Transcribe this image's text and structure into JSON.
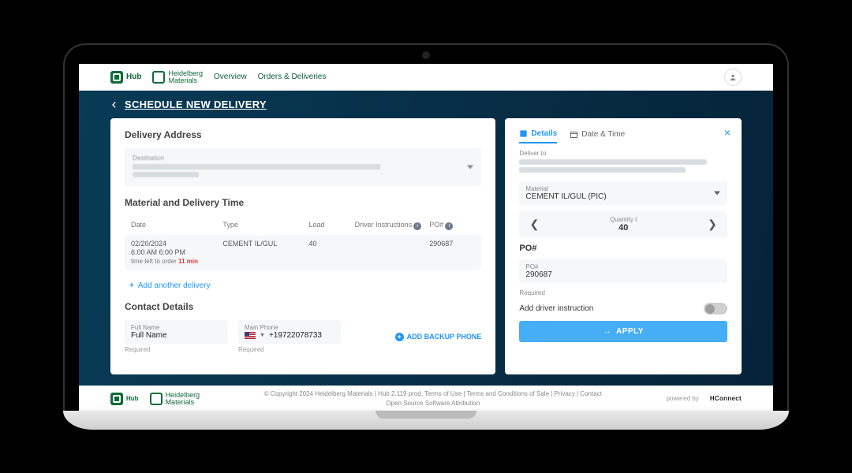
{
  "nav": {
    "hub": "Hub",
    "hm": "Heidelberg\nMaterials",
    "links": [
      "Overview",
      "Orders & Deliveries"
    ]
  },
  "page_title": "SCHEDULE NEW DELIVERY",
  "left": {
    "delivery_address_title": "Delivery Address",
    "dest_label": "Destination",
    "material_title": "Material and Delivery Time",
    "table": {
      "headers": [
        "Date",
        "Type",
        "Load",
        "Driver Instructions",
        "PO#"
      ],
      "row": {
        "date": "02/20/2024",
        "time": "6:00 AM 6:00 PM",
        "time_left_prefix": "time left to order",
        "time_left_value": "11 min",
        "type": "CEMENT IL/GUL",
        "load": "40",
        "po": "290687"
      }
    },
    "add_another": "Add another delivery",
    "contact_title": "Contact Details",
    "fullname_label": "Full Name",
    "fullname_value": "Full Name",
    "mainphone_label": "Main Phone",
    "mainphone_value": "+19722078733",
    "required": "Required",
    "add_backup": "ADD BACKUP PHONE"
  },
  "right": {
    "tab_details": "Details",
    "tab_datetime": "Date & Time",
    "deliver_to": "Deliver to",
    "material_label": "Material",
    "material_value": "CEMENT IL/GUL (PIC)",
    "qty_label": "Quantity t",
    "qty_value": "40",
    "po_title": "PO#",
    "po_label": "PO#",
    "po_value": "290687",
    "po_required": "Required",
    "driver_instruction": "Add driver instruction",
    "apply": "APPLY"
  },
  "footer": {
    "line1": "© Copyright 2024 Heidelberg Materials | Hub 2.119 prod. Terms of Use | Terms and Conditions of Sale | Privacy | Contact",
    "line2": "Open Source Software Attribution",
    "powered": "powered by",
    "hc": "HConnect"
  }
}
